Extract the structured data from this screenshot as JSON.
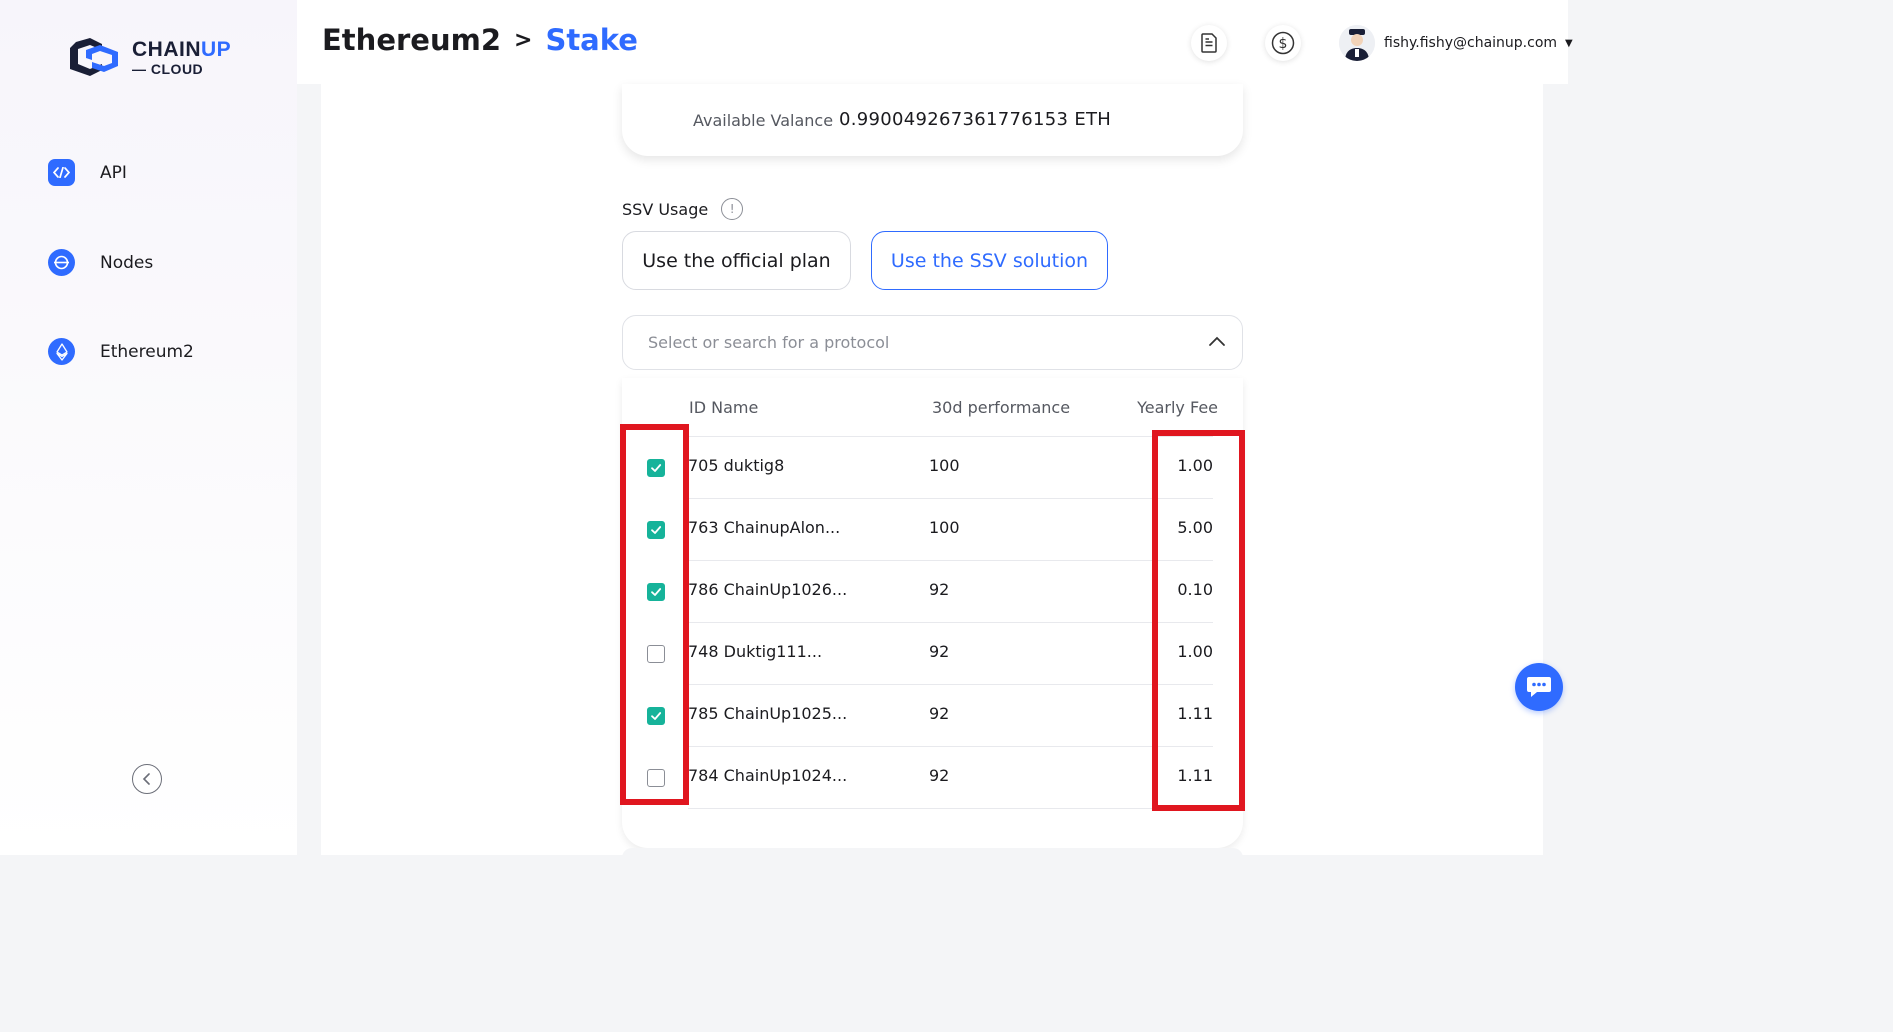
{
  "brand": {
    "name_main": "CHAIN",
    "name_accent": "UP",
    "name_sub": "— CLOUD"
  },
  "sidebar": {
    "items": [
      {
        "label": "API",
        "icon": "code-icon"
      },
      {
        "label": "Nodes",
        "icon": "nodes-icon"
      },
      {
        "label": "Ethereum2",
        "icon": "ethereum-icon"
      }
    ]
  },
  "header": {
    "breadcrumb_root": "Ethereum2",
    "breadcrumb_sep": ">",
    "breadcrumb_current": "Stake",
    "user_email": "fishy.fishy@chainup.com"
  },
  "balance": {
    "label": "Available Valance",
    "value": "0.990049267361776153 ETH"
  },
  "ssv": {
    "title": "SSV Usage",
    "info": "!",
    "official_plan": "Use the official plan",
    "ssv_solution": "Use the SSV solution"
  },
  "protocol_select": {
    "placeholder": "Select or search for a protocol"
  },
  "table": {
    "headers": {
      "name": "ID Name",
      "performance": "30d performance",
      "fee": "Yearly Fee"
    },
    "rows": [
      {
        "name": "705 duktig8",
        "performance": "100",
        "fee": "1.00",
        "checked": true
      },
      {
        "name": "763 ChainupAlon...",
        "performance": "100",
        "fee": "5.00",
        "checked": true
      },
      {
        "name": "786 ChainUp1026...",
        "performance": "92",
        "fee": "0.10",
        "checked": true
      },
      {
        "name": "748 Duktig111...",
        "performance": "92",
        "fee": "1.00",
        "checked": false
      },
      {
        "name": "785 ChainUp1025...",
        "performance": "92",
        "fee": "1.11",
        "checked": true
      },
      {
        "name": "784 ChainUp1024...",
        "performance": "92",
        "fee": "1.11",
        "checked": false
      }
    ]
  },
  "colors": {
    "accent": "#2f6bff",
    "check": "#16b39a",
    "highlight": "#e0161f"
  }
}
